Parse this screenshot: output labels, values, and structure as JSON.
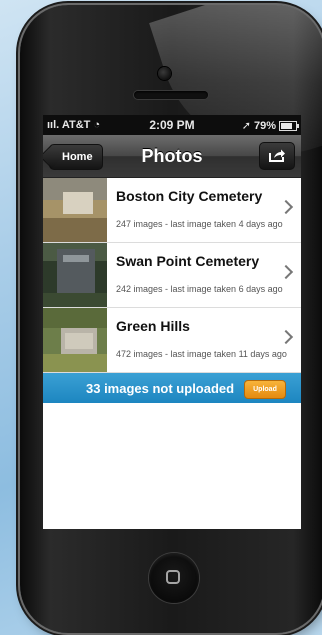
{
  "status_bar": {
    "carrier": "AT&T",
    "time": "2:09 PM",
    "battery": "79%"
  },
  "nav": {
    "back_label": "Home",
    "title": "Photos",
    "share_icon": "share-icon"
  },
  "cemeteries": [
    {
      "name": "Boston City Cemetery",
      "detail": "247 images - last image taken 4 days ago"
    },
    {
      "name": "Swan Point Cemetery",
      "detail": "242 images - last image taken 6 days ago"
    },
    {
      "name": "Green Hills",
      "detail": "472 images - last image taken 11 days ago"
    }
  ],
  "banner": {
    "text": "33 images not uploaded",
    "button_label": "Upload"
  },
  "colors": {
    "banner": "#1d86c0",
    "upload_button": "#e48a10"
  }
}
